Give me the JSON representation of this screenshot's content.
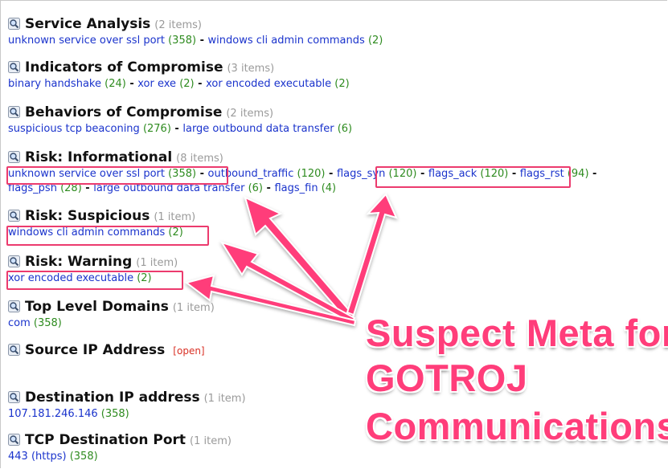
{
  "sections": [
    {
      "title": "Service Analysis",
      "count": "(2 items)",
      "lines": [
        [
          {
            "label": "unknown service over ssl port",
            "count": "(358)"
          },
          {
            "label": "windows cli admin commands",
            "count": "(2)"
          }
        ]
      ]
    },
    {
      "title": "Indicators of Compromise",
      "count": "(3 items)",
      "lines": [
        [
          {
            "label": "binary handshake",
            "count": "(24)"
          },
          {
            "label": "xor exe",
            "count": "(2)"
          },
          {
            "label": "xor encoded executable",
            "count": "(2)"
          }
        ]
      ]
    },
    {
      "title": "Behaviors of Compromise",
      "count": "(2 items)",
      "lines": [
        [
          {
            "label": "suspicious tcp beaconing",
            "count": "(276)"
          },
          {
            "label": "large outbound data transfer",
            "count": "(6)"
          }
        ]
      ]
    },
    {
      "title": "Risk: Informational",
      "count": "(8 items)",
      "lines": [
        [
          {
            "label": "unknown service over ssl port",
            "count": "(358)"
          },
          {
            "label": "outbound_traffic",
            "count": "(120)"
          },
          {
            "label": "flags_syn",
            "count": "(120)"
          },
          {
            "label": "flags_ack",
            "count": "(120)"
          },
          {
            "label": "flags_rst",
            "count": "(94)"
          }
        ],
        [
          {
            "label": "flags_psh",
            "count": "(28)"
          },
          {
            "label": "large outbound data transfer",
            "count": "(6)"
          },
          {
            "label": "flags_fin",
            "count": "(4)"
          }
        ]
      ]
    },
    {
      "title": "Risk: Suspicious",
      "count": "(1 item)",
      "lines": [
        [
          {
            "label": "windows cli admin commands",
            "count": "(2)"
          }
        ]
      ]
    },
    {
      "title": "Risk: Warning",
      "count": "(1 item)",
      "lines": [
        [
          {
            "label": "xor encoded executable",
            "count": "(2)"
          }
        ]
      ]
    },
    {
      "title": "Top Level Domains",
      "count": "(1 item)",
      "lines": [
        [
          {
            "label": "com",
            "count": "(358)"
          }
        ]
      ]
    },
    {
      "title": "Source IP Address",
      "count": "",
      "open": "[open]",
      "lines": []
    },
    {
      "title": "Destination IP address",
      "count": "(1 item)",
      "lines": [
        [
          {
            "label": "107.181.246.146",
            "count": "(358)"
          }
        ]
      ]
    },
    {
      "title": "TCP Destination Port",
      "count": "(1 item)",
      "lines": [
        [
          {
            "label": "443 (https)",
            "count": "(358)"
          }
        ]
      ]
    }
  ],
  "separator": " - ",
  "callout": {
    "line1": "Suspect Meta for",
    "line2": "GOTROJ",
    "line3": "Communications"
  },
  "colors": {
    "link": "#1a33cc",
    "count": "#2e8b1f",
    "annotation": "#ec3b6e",
    "callout": "#ff3d7a",
    "open": "#d93025"
  },
  "icons": {
    "section": "magnifier-icon"
  }
}
